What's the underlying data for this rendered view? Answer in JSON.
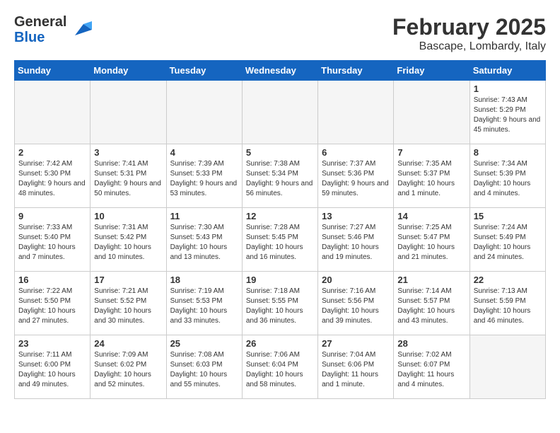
{
  "header": {
    "logo_line1": "General",
    "logo_line2": "Blue",
    "month": "February 2025",
    "location": "Bascape, Lombardy, Italy"
  },
  "columns": [
    "Sunday",
    "Monday",
    "Tuesday",
    "Wednesday",
    "Thursday",
    "Friday",
    "Saturday"
  ],
  "weeks": [
    [
      {
        "day": "",
        "info": ""
      },
      {
        "day": "",
        "info": ""
      },
      {
        "day": "",
        "info": ""
      },
      {
        "day": "",
        "info": ""
      },
      {
        "day": "",
        "info": ""
      },
      {
        "day": "",
        "info": ""
      },
      {
        "day": "1",
        "info": "Sunrise: 7:43 AM\nSunset: 5:29 PM\nDaylight: 9 hours and 45 minutes."
      }
    ],
    [
      {
        "day": "2",
        "info": "Sunrise: 7:42 AM\nSunset: 5:30 PM\nDaylight: 9 hours and 48 minutes."
      },
      {
        "day": "3",
        "info": "Sunrise: 7:41 AM\nSunset: 5:31 PM\nDaylight: 9 hours and 50 minutes."
      },
      {
        "day": "4",
        "info": "Sunrise: 7:39 AM\nSunset: 5:33 PM\nDaylight: 9 hours and 53 minutes."
      },
      {
        "day": "5",
        "info": "Sunrise: 7:38 AM\nSunset: 5:34 PM\nDaylight: 9 hours and 56 minutes."
      },
      {
        "day": "6",
        "info": "Sunrise: 7:37 AM\nSunset: 5:36 PM\nDaylight: 9 hours and 59 minutes."
      },
      {
        "day": "7",
        "info": "Sunrise: 7:35 AM\nSunset: 5:37 PM\nDaylight: 10 hours and 1 minute."
      },
      {
        "day": "8",
        "info": "Sunrise: 7:34 AM\nSunset: 5:39 PM\nDaylight: 10 hours and 4 minutes."
      }
    ],
    [
      {
        "day": "9",
        "info": "Sunrise: 7:33 AM\nSunset: 5:40 PM\nDaylight: 10 hours and 7 minutes."
      },
      {
        "day": "10",
        "info": "Sunrise: 7:31 AM\nSunset: 5:42 PM\nDaylight: 10 hours and 10 minutes."
      },
      {
        "day": "11",
        "info": "Sunrise: 7:30 AM\nSunset: 5:43 PM\nDaylight: 10 hours and 13 minutes."
      },
      {
        "day": "12",
        "info": "Sunrise: 7:28 AM\nSunset: 5:45 PM\nDaylight: 10 hours and 16 minutes."
      },
      {
        "day": "13",
        "info": "Sunrise: 7:27 AM\nSunset: 5:46 PM\nDaylight: 10 hours and 19 minutes."
      },
      {
        "day": "14",
        "info": "Sunrise: 7:25 AM\nSunset: 5:47 PM\nDaylight: 10 hours and 21 minutes."
      },
      {
        "day": "15",
        "info": "Sunrise: 7:24 AM\nSunset: 5:49 PM\nDaylight: 10 hours and 24 minutes."
      }
    ],
    [
      {
        "day": "16",
        "info": "Sunrise: 7:22 AM\nSunset: 5:50 PM\nDaylight: 10 hours and 27 minutes."
      },
      {
        "day": "17",
        "info": "Sunrise: 7:21 AM\nSunset: 5:52 PM\nDaylight: 10 hours and 30 minutes."
      },
      {
        "day": "18",
        "info": "Sunrise: 7:19 AM\nSunset: 5:53 PM\nDaylight: 10 hours and 33 minutes."
      },
      {
        "day": "19",
        "info": "Sunrise: 7:18 AM\nSunset: 5:55 PM\nDaylight: 10 hours and 36 minutes."
      },
      {
        "day": "20",
        "info": "Sunrise: 7:16 AM\nSunset: 5:56 PM\nDaylight: 10 hours and 39 minutes."
      },
      {
        "day": "21",
        "info": "Sunrise: 7:14 AM\nSunset: 5:57 PM\nDaylight: 10 hours and 43 minutes."
      },
      {
        "day": "22",
        "info": "Sunrise: 7:13 AM\nSunset: 5:59 PM\nDaylight: 10 hours and 46 minutes."
      }
    ],
    [
      {
        "day": "23",
        "info": "Sunrise: 7:11 AM\nSunset: 6:00 PM\nDaylight: 10 hours and 49 minutes."
      },
      {
        "day": "24",
        "info": "Sunrise: 7:09 AM\nSunset: 6:02 PM\nDaylight: 10 hours and 52 minutes."
      },
      {
        "day": "25",
        "info": "Sunrise: 7:08 AM\nSunset: 6:03 PM\nDaylight: 10 hours and 55 minutes."
      },
      {
        "day": "26",
        "info": "Sunrise: 7:06 AM\nSunset: 6:04 PM\nDaylight: 10 hours and 58 minutes."
      },
      {
        "day": "27",
        "info": "Sunrise: 7:04 AM\nSunset: 6:06 PM\nDaylight: 11 hours and 1 minute."
      },
      {
        "day": "28",
        "info": "Sunrise: 7:02 AM\nSunset: 6:07 PM\nDaylight: 11 hours and 4 minutes."
      },
      {
        "day": "",
        "info": ""
      }
    ]
  ]
}
